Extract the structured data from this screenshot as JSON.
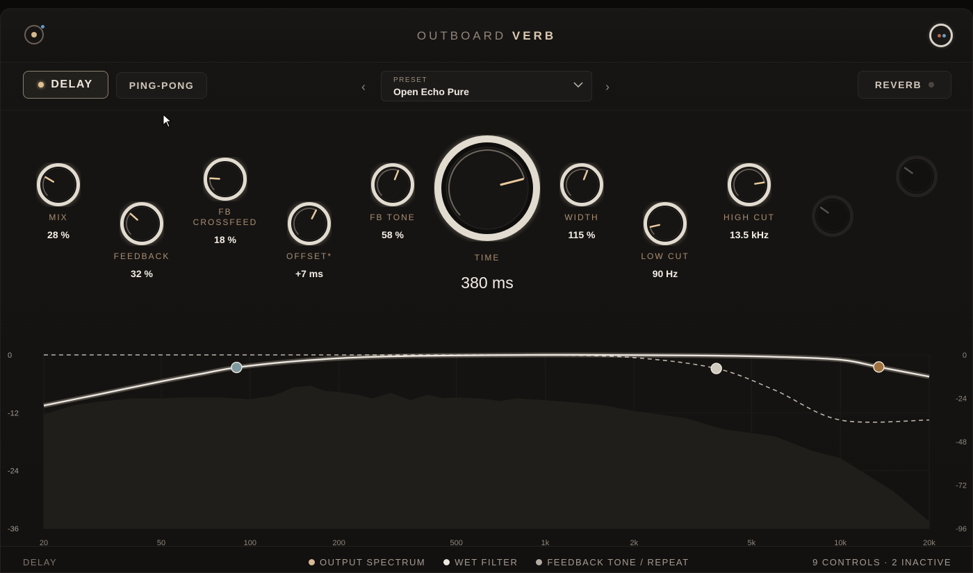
{
  "header": {
    "title_light": "OUTBOARD",
    "title_bold": "VERB",
    "logo_icon": "logo-icon",
    "power_icon": "power-icon"
  },
  "toolbar": {
    "delay_label": "DELAY",
    "pingpong_label": "PING-PONG",
    "reverb_label": "REVERB",
    "preset_label": "PRESET",
    "preset_value": "Open Echo Pure",
    "prev_arrow": "‹",
    "next_arrow": "›",
    "dropdown_icon": "chevron-down-icon"
  },
  "knobs": [
    {
      "id": "mix",
      "label": "MIX",
      "value": "28 %",
      "fraction": 0.28
    },
    {
      "id": "feedback",
      "label": "FEEDBACK",
      "value": "32 %",
      "fraction": 0.32
    },
    {
      "id": "fb-crossfeed",
      "label": "FB\nCROSSFEED",
      "value": "18 %",
      "fraction": 0.18
    },
    {
      "id": "offset",
      "label": "OFFSET*",
      "value": "+7 ms",
      "fraction": 0.6
    },
    {
      "id": "fb-tone",
      "label": "FB TONE",
      "value": "58 %",
      "fraction": 0.58
    },
    {
      "id": "time",
      "label": "TIME",
      "value": "380 ms",
      "fraction": 0.78
    },
    {
      "id": "width",
      "label": "WIDTH",
      "value": "115 %",
      "fraction": 0.58
    },
    {
      "id": "low-cut",
      "label": "LOW CUT",
      "value": "90 Hz",
      "fraction": 0.12
    },
    {
      "id": "high-cut",
      "label": "HIGH CUT",
      "value": "13.5 kHz",
      "fraction": 0.8
    },
    {
      "id": "inactive-1",
      "label": "",
      "value": "",
      "fraction": 0.3
    },
    {
      "id": "inactive-2",
      "label": "",
      "value": "",
      "fraction": 0.3
    }
  ],
  "chart_data": {
    "type": "line",
    "xscale": "log",
    "xlim": [
      20,
      20000
    ],
    "x_ticks": [
      "20",
      "50",
      "100",
      "200",
      "500",
      "1k",
      "2k",
      "5k",
      "10k",
      "20k"
    ],
    "left_axis_ticks": [
      "0",
      "-12",
      "-24",
      "-36"
    ],
    "right_axis_ticks": [
      "0",
      "-24",
      "-48",
      "-72",
      "-96"
    ],
    "ylim_left": [
      -36,
      0
    ],
    "ylim_right": [
      -96,
      0
    ],
    "series": [
      {
        "name": "WET FILTER",
        "x": [
          20,
          30,
          50,
          70,
          90,
          150,
          300,
          1000,
          3000,
          6000,
          10000,
          13500,
          20000
        ],
        "y": [
          -10.5,
          -8.3,
          -5.5,
          -3.8,
          -2.6,
          -1.2,
          -0.3,
          0,
          -0.1,
          -0.4,
          -1,
          -2.5,
          -4.5
        ]
      },
      {
        "name": "FEEDBACK TONE / REPEAT",
        "x": [
          20,
          500,
          1000,
          2000,
          3800,
          6000,
          10000,
          20000
        ],
        "y": [
          0,
          0,
          0,
          -0.5,
          -2.5,
          -6.5,
          -12,
          -12
        ]
      },
      {
        "name": "OUTPUT SPECTRUM",
        "x": [
          20,
          25,
          30,
          40,
          50,
          60,
          80,
          100,
          120,
          140,
          160,
          180,
          200,
          230,
          260,
          300,
          350,
          400,
          450,
          500,
          600,
          700,
          800,
          1000,
          1300,
          1600,
          2000,
          3000,
          4000,
          6000,
          8000,
          10000,
          15000,
          20000
        ],
        "y": [
          -33,
          -28,
          -26,
          -24,
          -24,
          -23.5,
          -23.5,
          -24.5,
          -22.5,
          -18,
          -17,
          -20,
          -20.5,
          -22,
          -24,
          -21,
          -25,
          -22,
          -24,
          -23.5,
          -24,
          -25.5,
          -24,
          -25,
          -26.5,
          -28,
          -31,
          -35,
          -41,
          -45,
          -53,
          -57,
          -75,
          -92
        ]
      }
    ],
    "handles": [
      {
        "name": "low-cut-handle",
        "x": 90,
        "y": -2.6,
        "color": "#7e9aa0"
      },
      {
        "name": "fb-tone-handle",
        "x": 3800,
        "y": -2.5,
        "color": "#cfc9bf"
      },
      {
        "name": "high-cut-handle",
        "x": 13500,
        "y": -2.5,
        "color": "#a0703e"
      }
    ]
  },
  "footer": {
    "mode_label": "DELAY",
    "legend": [
      {
        "label": "OUTPUT SPECTRUM",
        "color": "#d9b992"
      },
      {
        "label": "WET FILTER",
        "color": "#ece8e1"
      },
      {
        "label": "FEEDBACK TONE / REPEAT",
        "color": "#b4aca0"
      }
    ],
    "stats": "9 CONTROLS · 2 INACTIVE"
  },
  "colors": {
    "accent": "#d9b992",
    "background": "#141210",
    "knob_ring": "#e6dfd3",
    "indicator": "#e9c99b"
  }
}
